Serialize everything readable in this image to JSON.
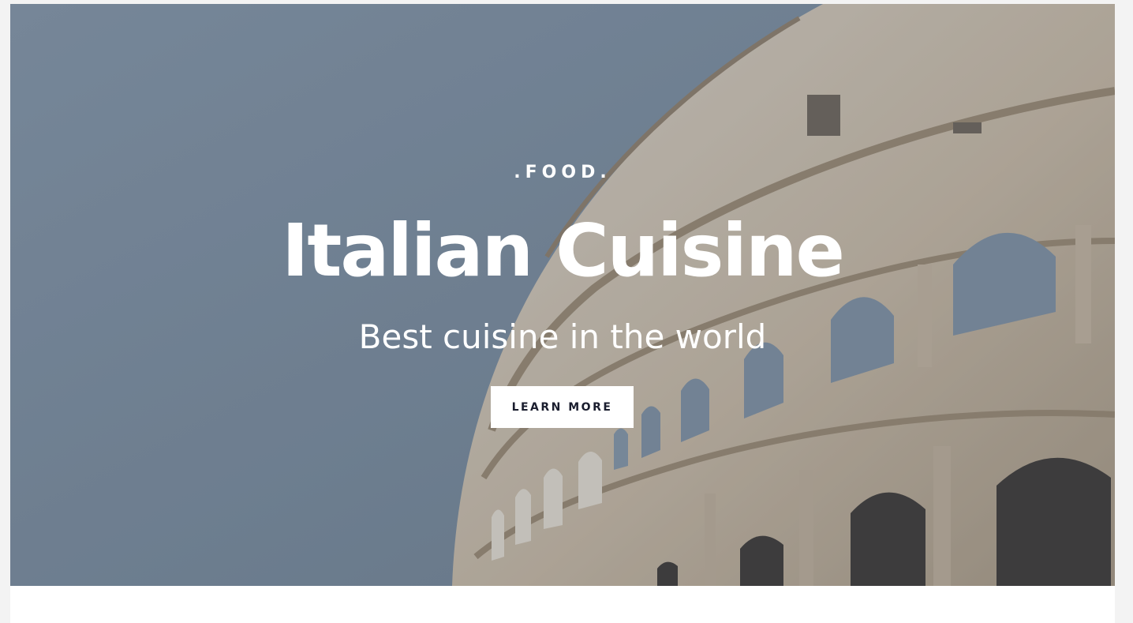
{
  "hero": {
    "eyebrow": ".FOOD.",
    "title": "Italian Cuisine",
    "subtitle": "Best cuisine in the world",
    "cta_label": "LEARN MORE",
    "image_subject": "colosseum",
    "colors": {
      "sky": "#7b8a9a",
      "stone_light": "#d9cfc2",
      "stone_dark": "#a8967f",
      "arch_shadow": "#3b3531",
      "text": "#ffffff",
      "button_bg": "#ffffff",
      "button_text": "#1a1d2e"
    }
  }
}
